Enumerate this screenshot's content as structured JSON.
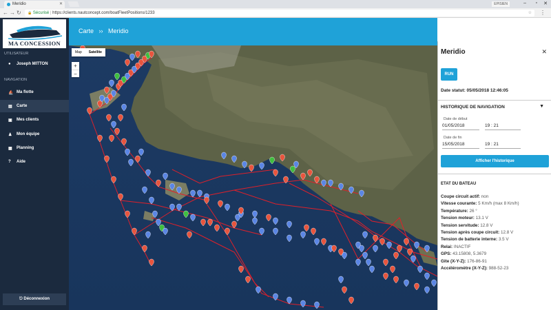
{
  "browser": {
    "tab_title": "Meridio",
    "user_label": "EPISIEN",
    "secure_label": "Sécurisé",
    "url": "https://clients.nautconcept.com/boatFleetPositions/1233"
  },
  "sidebar": {
    "logo_text": "MA CONCESSION",
    "user_section": "UTILISATEUR",
    "user_name": "Joseph MITTON",
    "nav_section": "NAVIGATION",
    "items": [
      {
        "label": "Ma flotte",
        "icon": "sailboat-icon"
      },
      {
        "label": "Carte",
        "icon": "map-icon"
      },
      {
        "label": "Mes clients",
        "icon": "address-book-icon"
      },
      {
        "label": "Mon équipe",
        "icon": "users-icon"
      },
      {
        "label": "Planning",
        "icon": "calendar-icon"
      },
      {
        "label": "Aide",
        "icon": "help-icon"
      }
    ],
    "logout_label": "Déconnexion"
  },
  "header": {
    "crumb_root": "Carte",
    "separator": "››",
    "crumb_current": "Meridio"
  },
  "map": {
    "type_options": [
      "Map",
      "Satellite"
    ],
    "selected_type": "Satellite",
    "zoom_in": "+",
    "zoom_out": "−"
  },
  "panel": {
    "title": "Meridio",
    "run_label": "RUN",
    "date_statut": "Date statut: 05/05/2018 12:46:05",
    "history_title": "HISTORIQUE DE NAVIGATION",
    "start_label": "Date de début",
    "start_date": "01/05/2018",
    "start_time": "19 : 21",
    "end_label": "Date de fin",
    "end_date": "15/05/2018",
    "end_time": "19 : 21",
    "show_history_label": "Afficher l'historique",
    "etat_title": "ETAT DU BATEAU",
    "stats": [
      {
        "label": "Coupe circuit actif:",
        "value": "non"
      },
      {
        "label": "Vitesse courante:",
        "value": "5 Km/h (max 8 Km/h)"
      },
      {
        "label": "Température:",
        "value": "26 °"
      },
      {
        "label": "Tension moteur:",
        "value": "13.1 V"
      },
      {
        "label": "Tension servitude:",
        "value": "12.8 V"
      },
      {
        "label": "Tension après coupe circuit:",
        "value": "12.8 V"
      },
      {
        "label": "Tension de batterie interne:",
        "value": "3.5 V"
      },
      {
        "label": "Relai:",
        "value": "INACTIF"
      },
      {
        "label": "GPS:",
        "value": "43.15808, 5.3679"
      },
      {
        "label": "Gite (X-Y-Z):",
        "value": "176-86-91"
      },
      {
        "label": "Accéléromètre (X-Y-Z):",
        "value": "988-52-23"
      }
    ]
  },
  "colors": {
    "accent": "#1fa2d8",
    "sidebar": "#1b2a3e",
    "track": "#e0202a",
    "marker_red": "#e8553e",
    "marker_blue": "#5b86e5",
    "marker_green": "#3fbf3f"
  }
}
